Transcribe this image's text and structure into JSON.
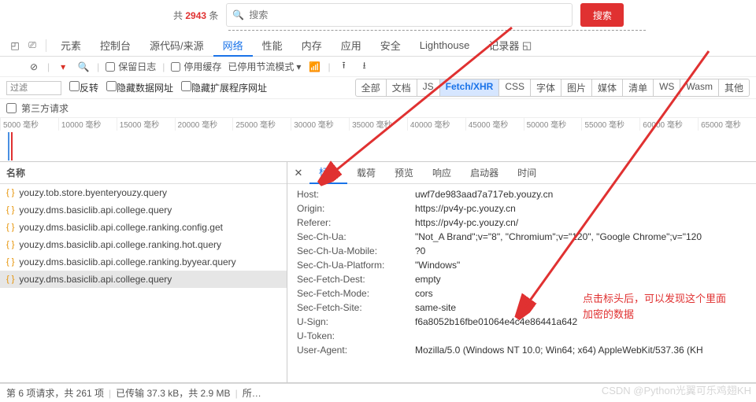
{
  "top": {
    "pre": "共 ",
    "count": "2943",
    "suf": " 条",
    "placeholder": "搜索",
    "search_btn": "搜索"
  },
  "devtabs": {
    "elements": "元素",
    "console": "控制台",
    "sources": "源代码/来源",
    "network": "网络",
    "performance": "性能",
    "memory": "内存",
    "application": "应用",
    "security": "安全",
    "lighthouse": "Lighthouse",
    "recorder": "记录器"
  },
  "ntrow": {
    "preserve": "保留日志",
    "disable_cache": "停用缓存",
    "throttle": "已停用节流模式"
  },
  "fltrow": {
    "filter_ph": "过滤",
    "invert": "反转",
    "hide_data": "隐藏数据网址",
    "hide_ext": "隐藏扩展程序网址",
    "types": [
      "全部",
      "文档",
      "JS",
      "Fetch/XHR",
      "CSS",
      "字体",
      "图片",
      "媒体",
      "清单",
      "WS",
      "Wasm",
      "其他"
    ],
    "active": "Fetch/XHR"
  },
  "tp": {
    "label": "第三方请求"
  },
  "timeline_ticks": [
    "5000 毫秒",
    "10000 毫秒",
    "15000 毫秒",
    "20000 毫秒",
    "25000 毫秒",
    "30000 毫秒",
    "35000 毫秒",
    "40000 毫秒",
    "45000 毫秒",
    "50000 毫秒",
    "55000 毫秒",
    "60000 毫秒",
    "65000 毫秒"
  ],
  "reqs": {
    "header": "名称",
    "items": [
      "youzy.tob.store.byenteryouzy.query",
      "youzy.dms.basiclib.api.college.query",
      "youzy.dms.basiclib.api.college.ranking.config.get",
      "youzy.dms.basiclib.api.college.ranking.hot.query",
      "youzy.dms.basiclib.api.college.ranking.byyear.query",
      "youzy.dms.basiclib.api.college.query"
    ],
    "selected": 5
  },
  "detail_tabs": [
    "标头",
    "载荷",
    "预览",
    "响应",
    "启动器",
    "时间"
  ],
  "detail_active": "标头",
  "headers": [
    {
      "k": "Host:",
      "v": "uwf7de983aad7a717eb.youzy.cn"
    },
    {
      "k": "Origin:",
      "v": "https://pv4y-pc.youzy.cn"
    },
    {
      "k": "Referer:",
      "v": "https://pv4y-pc.youzy.cn/"
    },
    {
      "k": "Sec-Ch-Ua:",
      "v": "\"Not_A Brand\";v=\"8\", \"Chromium\";v=\"120\", \"Google Chrome\";v=\"120"
    },
    {
      "k": "Sec-Ch-Ua-Mobile:",
      "v": "?0"
    },
    {
      "k": "Sec-Ch-Ua-Platform:",
      "v": "\"Windows\""
    },
    {
      "k": "Sec-Fetch-Dest:",
      "v": "empty"
    },
    {
      "k": "Sec-Fetch-Mode:",
      "v": "cors"
    },
    {
      "k": "Sec-Fetch-Site:",
      "v": "same-site"
    },
    {
      "k": "U-Sign:",
      "v": "f6a8052b16fbe01064e4c4e86441a642"
    },
    {
      "k": "U-Token:",
      "v": ""
    },
    {
      "k": "User-Agent:",
      "v": "Mozilla/5.0 (Windows NT 10.0; Win64; x64) AppleWebKit/537.36 (KH"
    }
  ],
  "status": {
    "s1": "第 6 项请求，共 261 项",
    "s2": "已传输 37.3 kB，共 2.9 MB",
    "s3": "所…"
  },
  "note": "点击标头后，可以发现这个里面\n加密的数据",
  "watermark": "CSDN @Python光翼可乐鸡翅KH"
}
